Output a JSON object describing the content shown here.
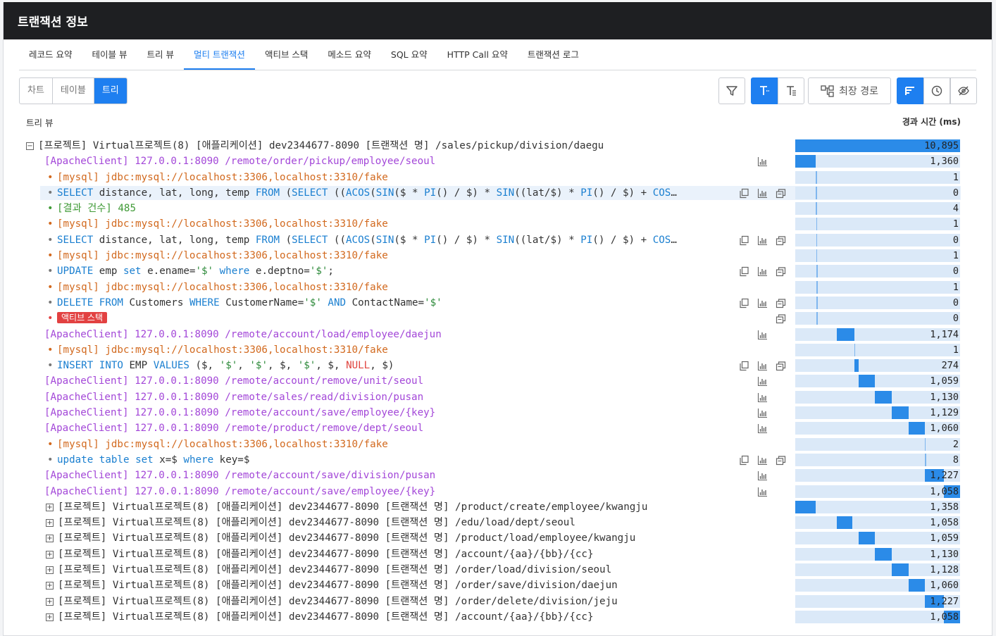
{
  "title": "트랜잭션 정보",
  "tabs": [
    "레코드 요약",
    "테이블 뷰",
    "트리 뷰",
    "멀티 트랜잭션",
    "액티브 스택",
    "메소드 요약",
    "SQL 요약",
    "HTTP Call 요약",
    "트랜잭션 로그"
  ],
  "active_tab": "멀티 트랜잭션",
  "view_toggle": {
    "chart": "차트",
    "table": "테이블",
    "tree": "트리",
    "selected": "트리"
  },
  "toolbar": {
    "critical_path_label": "최장 경로"
  },
  "tree_title": "트리 뷰",
  "elapsed_header": "경과 시간 (ms)",
  "icon_names": [
    "filter-icon",
    "text-wrap-icon",
    "text-clip-icon",
    "critical-path-icon",
    "sort-icon",
    "clock-icon",
    "hide-icon",
    "copy-icon",
    "chart-icon",
    "stack-icon",
    "expand-icon",
    "collapse-icon"
  ],
  "colors": {
    "accent": "#1e7ff0",
    "title_bg": "#1e1f22",
    "apache": "#a347d8",
    "mysql": "#d2691e",
    "sql_keyword": "#1a7fd0",
    "result": "#3f9a36",
    "badge": "#e24141",
    "bar_bg": "#dbe9f8",
    "bar_fill": "#2b8be8"
  },
  "rows": [
    {
      "kind": "project",
      "expanded": true,
      "text": "[프로젝트] Virtual프로젝트(8) [애플리케이션] dev2344677-8090 [트랜잭션 명] /sales/pickup/division/daegu",
      "elapsed": "10,895",
      "bar_start": 0,
      "bar_end": 1
    },
    {
      "kind": "apache",
      "text": "[ApacheClient] 127.0.0.1:8090 /remote/order/pickup/employee/seoul",
      "icons": [
        "chart"
      ],
      "elapsed": "1,360",
      "bar_start": 0,
      "bar_end": 0.125
    },
    {
      "kind": "mysql",
      "text": "[mysql] jdbc:mysql://localhost:3306,localhost:3310/fake",
      "elapsed": "1",
      "bar_start": 0.125,
      "bar_end": 0.126
    },
    {
      "kind": "sql",
      "highlight": true,
      "text": "SELECT distance, lat, long, temp FROM (SELECT ((ACOS(SIN($ * PI() / $) * SIN((lat/$) * PI() / $) + COS…",
      "icons": [
        "copy",
        "chart",
        "stack"
      ],
      "elapsed": "0",
      "bar_start": 0.126,
      "bar_end": 0.126
    },
    {
      "kind": "result",
      "text": "[결과 건수] 485",
      "elapsed": "4",
      "bar_start": 0.126,
      "bar_end": 0.127
    },
    {
      "kind": "mysql",
      "text": "[mysql] jdbc:mysql://localhost:3306,localhost:3310/fake",
      "elapsed": "1",
      "bar_start": 0.127,
      "bar_end": 0.128
    },
    {
      "kind": "sql",
      "text": "SELECT distance, lat, long, temp FROM (SELECT ((ACOS(SIN($ * PI() / $) * SIN((lat/$) * PI() / $) + COS…",
      "icons": [
        "copy",
        "chart",
        "stack"
      ],
      "elapsed": "0",
      "bar_start": 0.128,
      "bar_end": 0.128
    },
    {
      "kind": "mysql",
      "text": "[mysql] jdbc:mysql://localhost:3306,localhost:3310/fake",
      "elapsed": "1",
      "bar_start": 0.128,
      "bar_end": 0.129
    },
    {
      "kind": "sql",
      "text": "UPDATE emp set e.ename='$' where e.deptno='$';",
      "icons": [
        "copy",
        "chart",
        "stack"
      ],
      "elapsed": "0",
      "bar_start": 0.129,
      "bar_end": 0.129
    },
    {
      "kind": "mysql",
      "text": "[mysql] jdbc:mysql://localhost:3306,localhost:3310/fake",
      "elapsed": "1",
      "bar_start": 0.129,
      "bar_end": 0.13
    },
    {
      "kind": "sql",
      "text": "DELETE FROM Customers WHERE CustomerName='$' AND ContactName='$'",
      "icons": [
        "copy",
        "chart",
        "stack"
      ],
      "elapsed": "0",
      "bar_start": 0.13,
      "bar_end": 0.13
    },
    {
      "kind": "badge",
      "text": "액티브 스택",
      "icons": [
        "stack"
      ],
      "elapsed": "0",
      "bar_start": 0.13,
      "bar_end": 0.13
    },
    {
      "kind": "apache",
      "text": "[ApacheClient] 127.0.0.1:8090 /remote/account/load/employee/daejun",
      "icons": [
        "chart"
      ],
      "elapsed": "1,174",
      "bar_start": 0.25,
      "bar_end": 0.358
    },
    {
      "kind": "mysql",
      "text": "[mysql] jdbc:mysql://localhost:3306,localhost:3310/fake",
      "elapsed": "1",
      "bar_start": 0.358,
      "bar_end": 0.359
    },
    {
      "kind": "sql",
      "text": "INSERT INTO EMP VALUES ($, '$', '$', $, '$', $, NULL, $)",
      "icons": [
        "copy",
        "chart",
        "stack"
      ],
      "elapsed": "274",
      "bar_start": 0.359,
      "bar_end": 0.384
    },
    {
      "kind": "apache",
      "text": "[ApacheClient] 127.0.0.1:8090 /remote/account/remove/unit/seoul",
      "icons": [
        "chart"
      ],
      "elapsed": "1,059",
      "bar_start": 0.384,
      "bar_end": 0.481
    },
    {
      "kind": "apache",
      "text": "[ApacheClient] 127.0.0.1:8090 /remote/sales/read/division/pusan",
      "icons": [
        "chart"
      ],
      "elapsed": "1,130",
      "bar_start": 0.481,
      "bar_end": 0.585
    },
    {
      "kind": "apache",
      "text": "[ApacheClient] 127.0.0.1:8090 /remote/account/save/employee/{key}",
      "icons": [
        "chart"
      ],
      "elapsed": "1,129",
      "bar_start": 0.585,
      "bar_end": 0.689
    },
    {
      "kind": "apache",
      "text": "[ApacheClient] 127.0.0.1:8090 /remote/product/remove/dept/seoul",
      "icons": [
        "chart"
      ],
      "elapsed": "1,060",
      "bar_start": 0.689,
      "bar_end": 0.786
    },
    {
      "kind": "mysql",
      "text": "[mysql] jdbc:mysql://localhost:3306,localhost:3310/fake",
      "elapsed": "2",
      "bar_start": 0.786,
      "bar_end": 0.787
    },
    {
      "kind": "sql",
      "text": "update table set x=$ where key=$",
      "icons": [
        "copy",
        "chart",
        "stack"
      ],
      "elapsed": "8",
      "bar_start": 0.787,
      "bar_end": 0.788
    },
    {
      "kind": "apache",
      "text": "[ApacheClient] 127.0.0.1:8090 /remote/account/save/division/pusan",
      "icons": [
        "chart"
      ],
      "elapsed": "1,227",
      "bar_start": 0.788,
      "bar_end": 0.9
    },
    {
      "kind": "apache",
      "text": "[ApacheClient] 127.0.0.1:8090 /remote/account/save/employee/{key}",
      "icons": [
        "chart"
      ],
      "elapsed": "1,058",
      "bar_start": 0.9,
      "bar_end": 1
    },
    {
      "kind": "project",
      "expanded": false,
      "text": "[프로젝트] Virtual프로젝트(8) [애플리케이션] dev2344677-8090 [트랜잭션 명] /product/create/employee/kwangju",
      "elapsed": "1,358",
      "bar_start": 0,
      "bar_end": 0.125
    },
    {
      "kind": "project",
      "expanded": false,
      "text": "[프로젝트] Virtual프로젝트(8) [애플리케이션] dev2344677-8090 [트랜잭션 명] /edu/load/dept/seoul",
      "elapsed": "1,058",
      "bar_start": 0.25,
      "bar_end": 0.347
    },
    {
      "kind": "project",
      "expanded": false,
      "text": "[프로젝트] Virtual프로젝트(8) [애플리케이션] dev2344677-8090 [트랜잭션 명] /product/load/employee/kwangju",
      "elapsed": "1,059",
      "bar_start": 0.384,
      "bar_end": 0.481
    },
    {
      "kind": "project",
      "expanded": false,
      "text": "[프로젝트] Virtual프로젝트(8) [애플리케이션] dev2344677-8090 [트랜잭션 명] /account/{aa}/{bb}/{cc}",
      "elapsed": "1,130",
      "bar_start": 0.481,
      "bar_end": 0.585
    },
    {
      "kind": "project",
      "expanded": false,
      "text": "[프로젝트] Virtual프로젝트(8) [애플리케이션] dev2344677-8090 [트랜잭션 명] /order/load/division/seoul",
      "elapsed": "1,128",
      "bar_start": 0.585,
      "bar_end": 0.689
    },
    {
      "kind": "project",
      "expanded": false,
      "text": "[프로젝트] Virtual프로젝트(8) [애플리케이션] dev2344677-8090 [트랜잭션 명] /order/save/division/daejun",
      "elapsed": "1,060",
      "bar_start": 0.689,
      "bar_end": 0.786
    },
    {
      "kind": "project",
      "expanded": false,
      "text": "[프로젝트] Virtual프로젝트(8) [애플리케이션] dev2344677-8090 [트랜잭션 명] /order/delete/division/jeju",
      "elapsed": "1,227",
      "bar_start": 0.788,
      "bar_end": 0.9
    },
    {
      "kind": "project",
      "expanded": false,
      "text": "[프로젝트] Virtual프로젝트(8) [애플리케이션] dev2344677-8090 [트랜잭션 명] /account/{aa}/{bb}/{cc}",
      "elapsed": "1,058",
      "bar_start": 0.9,
      "bar_end": 1
    }
  ]
}
